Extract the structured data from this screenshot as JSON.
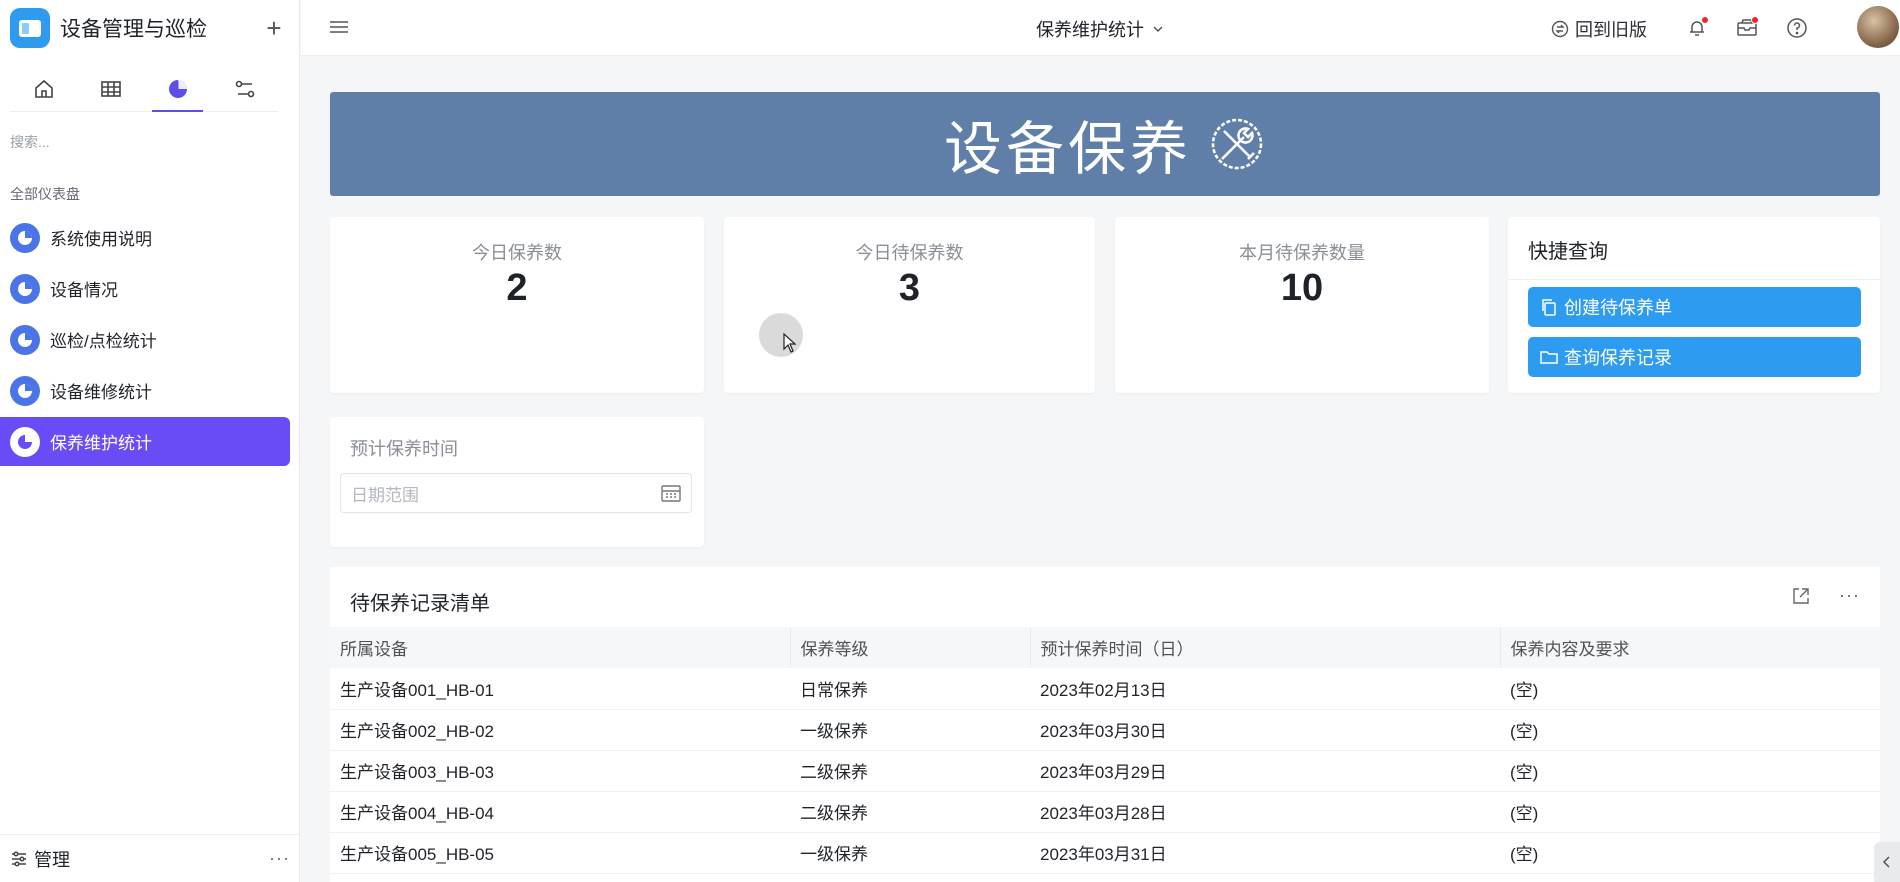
{
  "app": {
    "title": "设备管理与巡检",
    "add_label": "+"
  },
  "sidebar": {
    "tabs": [
      {
        "icon": "home-icon"
      },
      {
        "icon": "table-icon"
      },
      {
        "icon": "dashboard-pie-icon"
      },
      {
        "icon": "workflow-icon"
      }
    ],
    "search_placeholder": "搜索...",
    "section_title": "全部仪表盘",
    "items": [
      {
        "label": "系统使用说明"
      },
      {
        "label": "设备情况"
      },
      {
        "label": "巡检/点检统计"
      },
      {
        "label": "设备维修统计"
      },
      {
        "label": "保养维护统计",
        "active": true
      }
    ],
    "footer": {
      "label": "管理",
      "more": "···"
    }
  },
  "topbar": {
    "page_title": "保养维护统计",
    "back_old": "回到旧版"
  },
  "banner": {
    "title": "设备保养"
  },
  "stats": [
    {
      "label": "今日保养数",
      "value": "2"
    },
    {
      "label": "今日待保养数",
      "value": "3"
    },
    {
      "label": "本月待保养数量",
      "value": "10"
    }
  ],
  "quick": {
    "title": "快捷查询",
    "create_label": "创建待保养单",
    "query_label": "查询保养记录"
  },
  "filter": {
    "label": "预计保养时间",
    "placeholder": "日期范围"
  },
  "table": {
    "title": "待保养记录清单",
    "columns": [
      "所属设备",
      "保养等级",
      "预计保养时间（日）",
      "保养内容及要求"
    ],
    "rows": [
      [
        "生产设备001_HB-01",
        "日常保养",
        "2023年02月13日",
        "(空)"
      ],
      [
        "生产设备002_HB-02",
        "一级保养",
        "2023年03月30日",
        "(空)"
      ],
      [
        "生产设备003_HB-03",
        "二级保养",
        "2023年03月29日",
        "(空)"
      ],
      [
        "生产设备004_HB-04",
        "二级保养",
        "2023年03月28日",
        "(空)"
      ],
      [
        "生产设备005_HB-05",
        "一级保养",
        "2023年03月31日",
        "(空)"
      ]
    ]
  },
  "colors": {
    "accent": "#6a4cf6",
    "banner": "#5f7fa8",
    "button": "#2d9cf0"
  }
}
